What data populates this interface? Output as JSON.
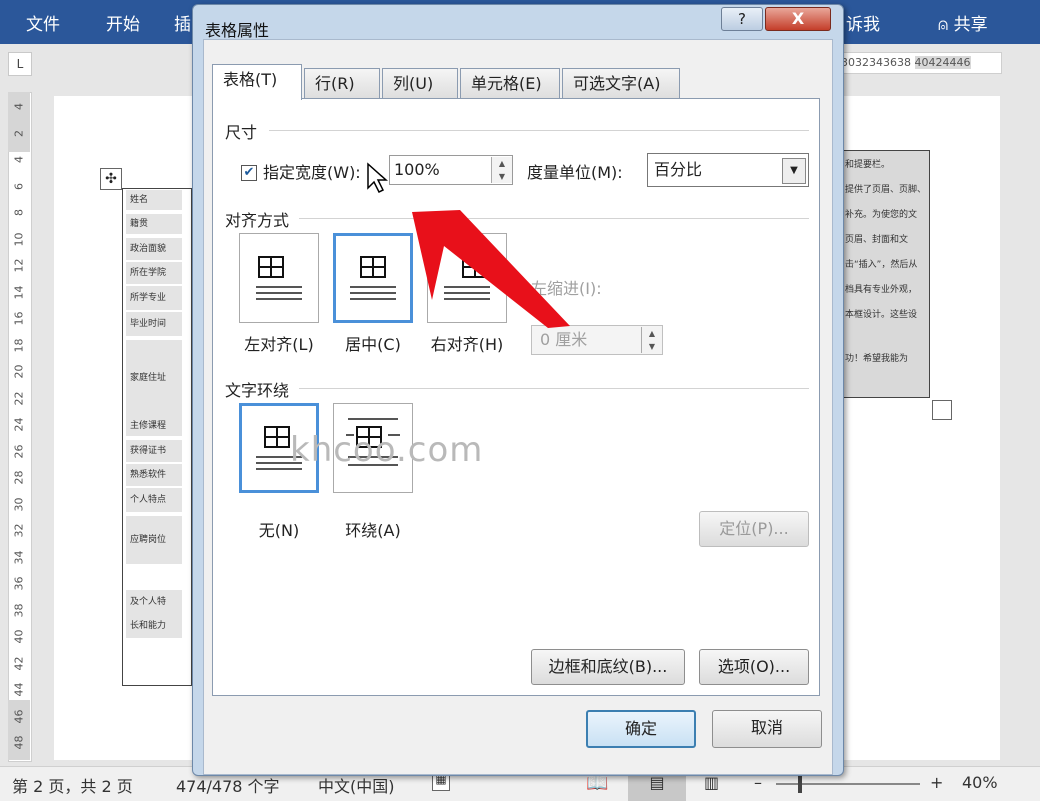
{
  "ribbon": {
    "tabs": [
      "文件",
      "开始",
      "插"
    ],
    "tell_me": "诉我",
    "share": "共享",
    "color": "#2b579a"
  },
  "ruler": {
    "corner": "L",
    "right_numbers_a": "3032343638",
    "right_numbers_b": "40424446",
    "vertical": [
      "4",
      "2",
      "4",
      "6",
      "8",
      "10",
      "12",
      "14",
      "16",
      "18",
      "20",
      "22",
      "24",
      "26",
      "28",
      "30",
      "32",
      "34",
      "36",
      "38",
      "40",
      "42",
      "44",
      "46",
      "48"
    ]
  },
  "document": {
    "table_labels": [
      "姓名",
      "籍贯",
      "政治面貌",
      "所在学院",
      "所学专业",
      "毕业时间",
      "家庭住址",
      "主修课程",
      "获得证书",
      "熟悉软件",
      "个人特点",
      "应聘岗位",
      "及个人特",
      "长和能力"
    ],
    "right_text": [
      "和提要栏。",
      "提供了页眉、页脚、",
      "补充。为使您的文",
      "页眉、封面和文",
      "击“插入”，然后从",
      "档具有专业外观，",
      "本框设计。这些设",
      "功！希望我能为"
    ]
  },
  "dialog": {
    "title": "表格属性",
    "help": "?",
    "close": "X",
    "tabs": [
      "表格(T)",
      "行(R)",
      "列(U)",
      "单元格(E)",
      "可选文字(A)"
    ],
    "size_section": "尺寸",
    "specify_width_label": "指定宽度(W):",
    "specify_width_checked": true,
    "width_value": "100%",
    "unit_label": "度量单位(M):",
    "unit_value": "百分比",
    "align_section": "对齐方式",
    "align_options": [
      "左对齐(L)",
      "居中(C)",
      "右对齐(H)"
    ],
    "align_selected": "居中(C)",
    "indent_label": "左缩进(I):",
    "indent_value": "0 厘米",
    "wrap_section": "文字环绕",
    "wrap_options": [
      "无(N)",
      "环绕(A)"
    ],
    "wrap_selected": "无(N)",
    "position_button": "定位(P)...",
    "borders_button": "边框和底纹(B)...",
    "options_button": "选项(O)...",
    "ok_button": "确定",
    "cancel_button": "取消"
  },
  "watermark": "khcoo.com",
  "status": {
    "page": "第 2 页，共 2 页",
    "words": "474/478 个字",
    "language": "中文(中国)",
    "zoom_minus": "–",
    "zoom_plus": "+",
    "zoom": "40%"
  },
  "annotation": {
    "arrow_color": "#e8101a"
  }
}
